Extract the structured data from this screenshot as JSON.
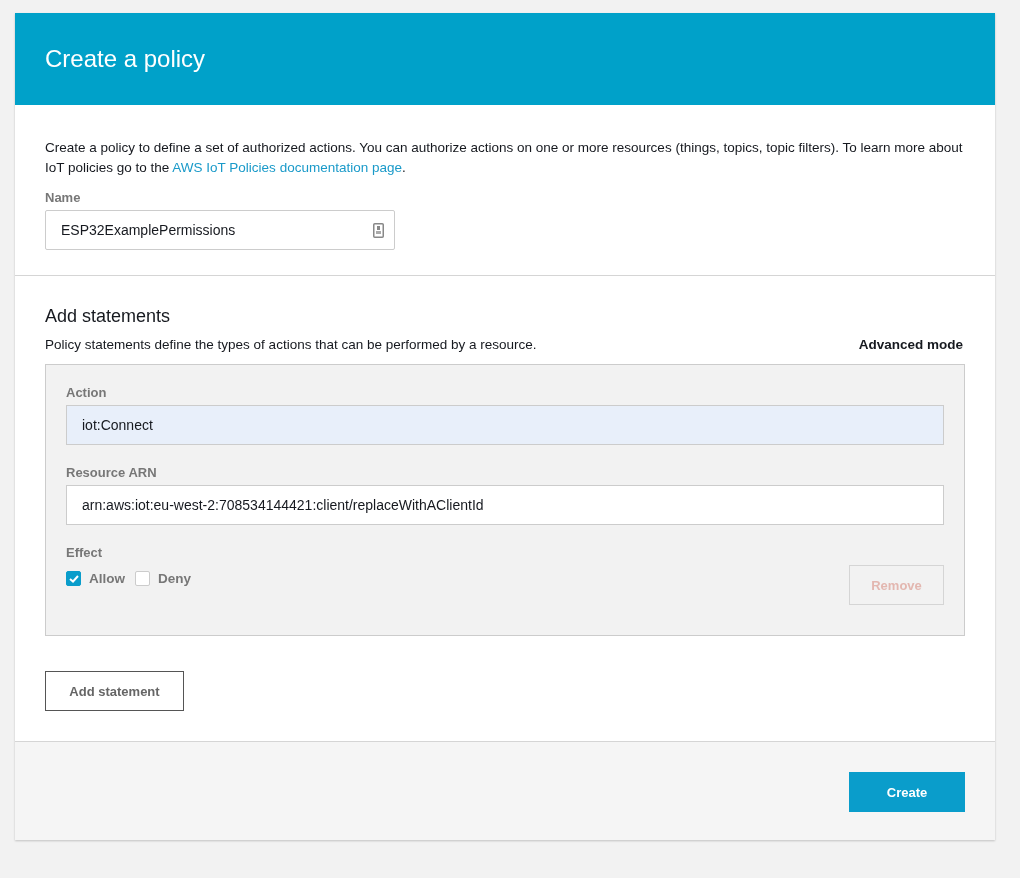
{
  "header": {
    "title": "Create a policy"
  },
  "intro": {
    "before": "Create a policy to define a set of authorized actions. You can authorize actions on one or more resources (things, topics, topic filters). To learn more about IoT policies go to the ",
    "link": "AWS IoT Policies documentation page",
    "after": "."
  },
  "name_field": {
    "label": "Name",
    "value": "ESP32ExamplePermissions"
  },
  "statements": {
    "title": "Add statements",
    "description": "Policy statements define the types of actions that can be performed by a resource.",
    "advanced_mode": "Advanced mode",
    "items": [
      {
        "action_label": "Action",
        "action": "iot:Connect",
        "resource_label": "Resource ARN",
        "resource": "arn:aws:iot:eu-west-2:708534144421:client/replaceWithAClientId",
        "effect_label": "Effect",
        "effects": [
          {
            "label": "Allow",
            "checked": true
          },
          {
            "label": "Deny",
            "checked": false
          }
        ],
        "remove": {
          "label": "Remove",
          "disabled": true
        }
      }
    ],
    "add_button": "Add statement"
  },
  "footer": {
    "create_button": "Create"
  }
}
